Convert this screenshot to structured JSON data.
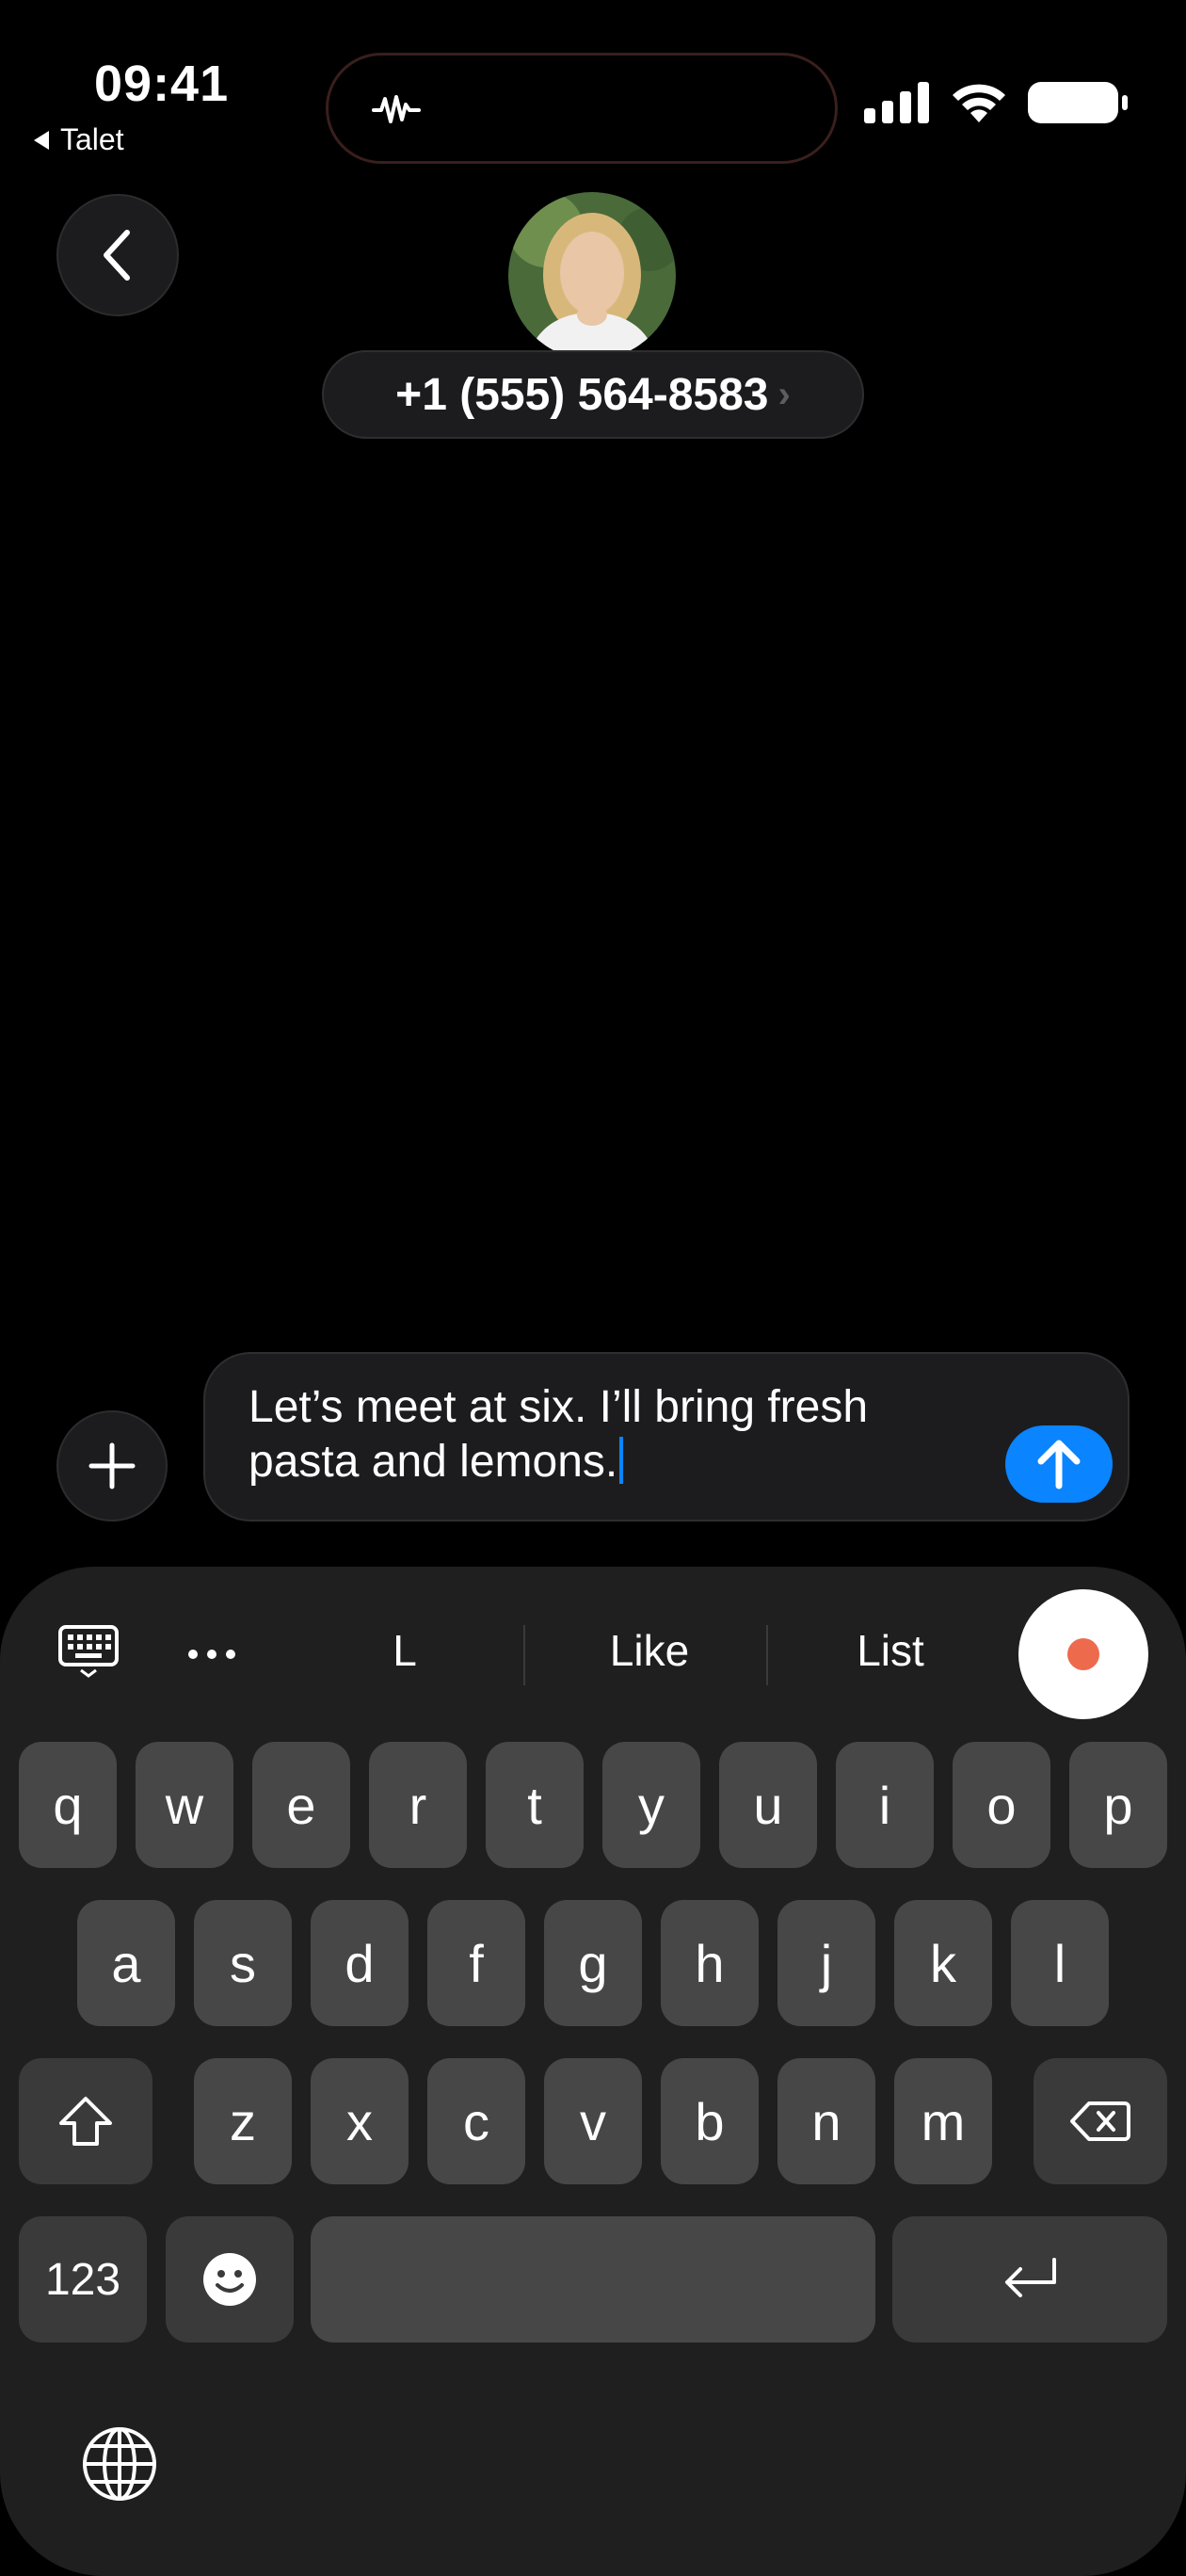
{
  "status_bar": {
    "time": "09:41",
    "back_app": "Talet"
  },
  "header": {
    "contact_number": "+1 (555) 564-8583",
    "chevron": "›"
  },
  "compose": {
    "message_text": "Let’s meet at six. I’ll bring fresh pasta and lemons.",
    "send_icon": "arrow-up-icon",
    "add_icon": "plus-icon"
  },
  "keyboard": {
    "suggestions": [
      "L",
      "Like",
      "List"
    ],
    "row1": [
      "q",
      "w",
      "e",
      "r",
      "t",
      "y",
      "u",
      "i",
      "o",
      "p"
    ],
    "row2": [
      "a",
      "s",
      "d",
      "f",
      "g",
      "h",
      "j",
      "k",
      "l"
    ],
    "row3": [
      "z",
      "x",
      "c",
      "v",
      "b",
      "n",
      "m"
    ],
    "numbers_key": "123",
    "icons": {
      "keyboard_toggle": "keyboard-icon",
      "more": "ellipsis-icon",
      "record": "record-icon",
      "shift": "shift-icon",
      "delete": "delete-icon",
      "emoji": "emoji-icon",
      "return": "return-icon",
      "globe": "globe-icon"
    }
  },
  "colors": {
    "accent": "#0a84ff",
    "record": "#ee6a4d",
    "background": "#000000",
    "keyboard_bg": "#1f1f1f",
    "key_bg": "#474747"
  }
}
